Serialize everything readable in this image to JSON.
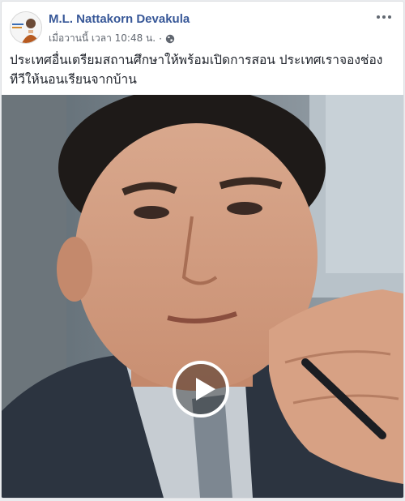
{
  "post": {
    "author": "M.L. Nattakorn Devakula",
    "timestamp": "เมื่อวานนี้ เวลา 10:48 น.",
    "separator": "·",
    "privacy_icon": "globe-icon",
    "more_icon": "more-options-icon",
    "text": "ประเทศอื่นเตรียมสถานศึกษาให้พร้อมเปิดการสอน ประเทศเราจองช่องทีวีให้นอนเรียนจากบ้าน"
  },
  "video": {
    "play_icon": "play-icon"
  },
  "colors": {
    "author_link": "#385898",
    "meta_text": "#616770",
    "page_bg": "#e9ebee"
  }
}
